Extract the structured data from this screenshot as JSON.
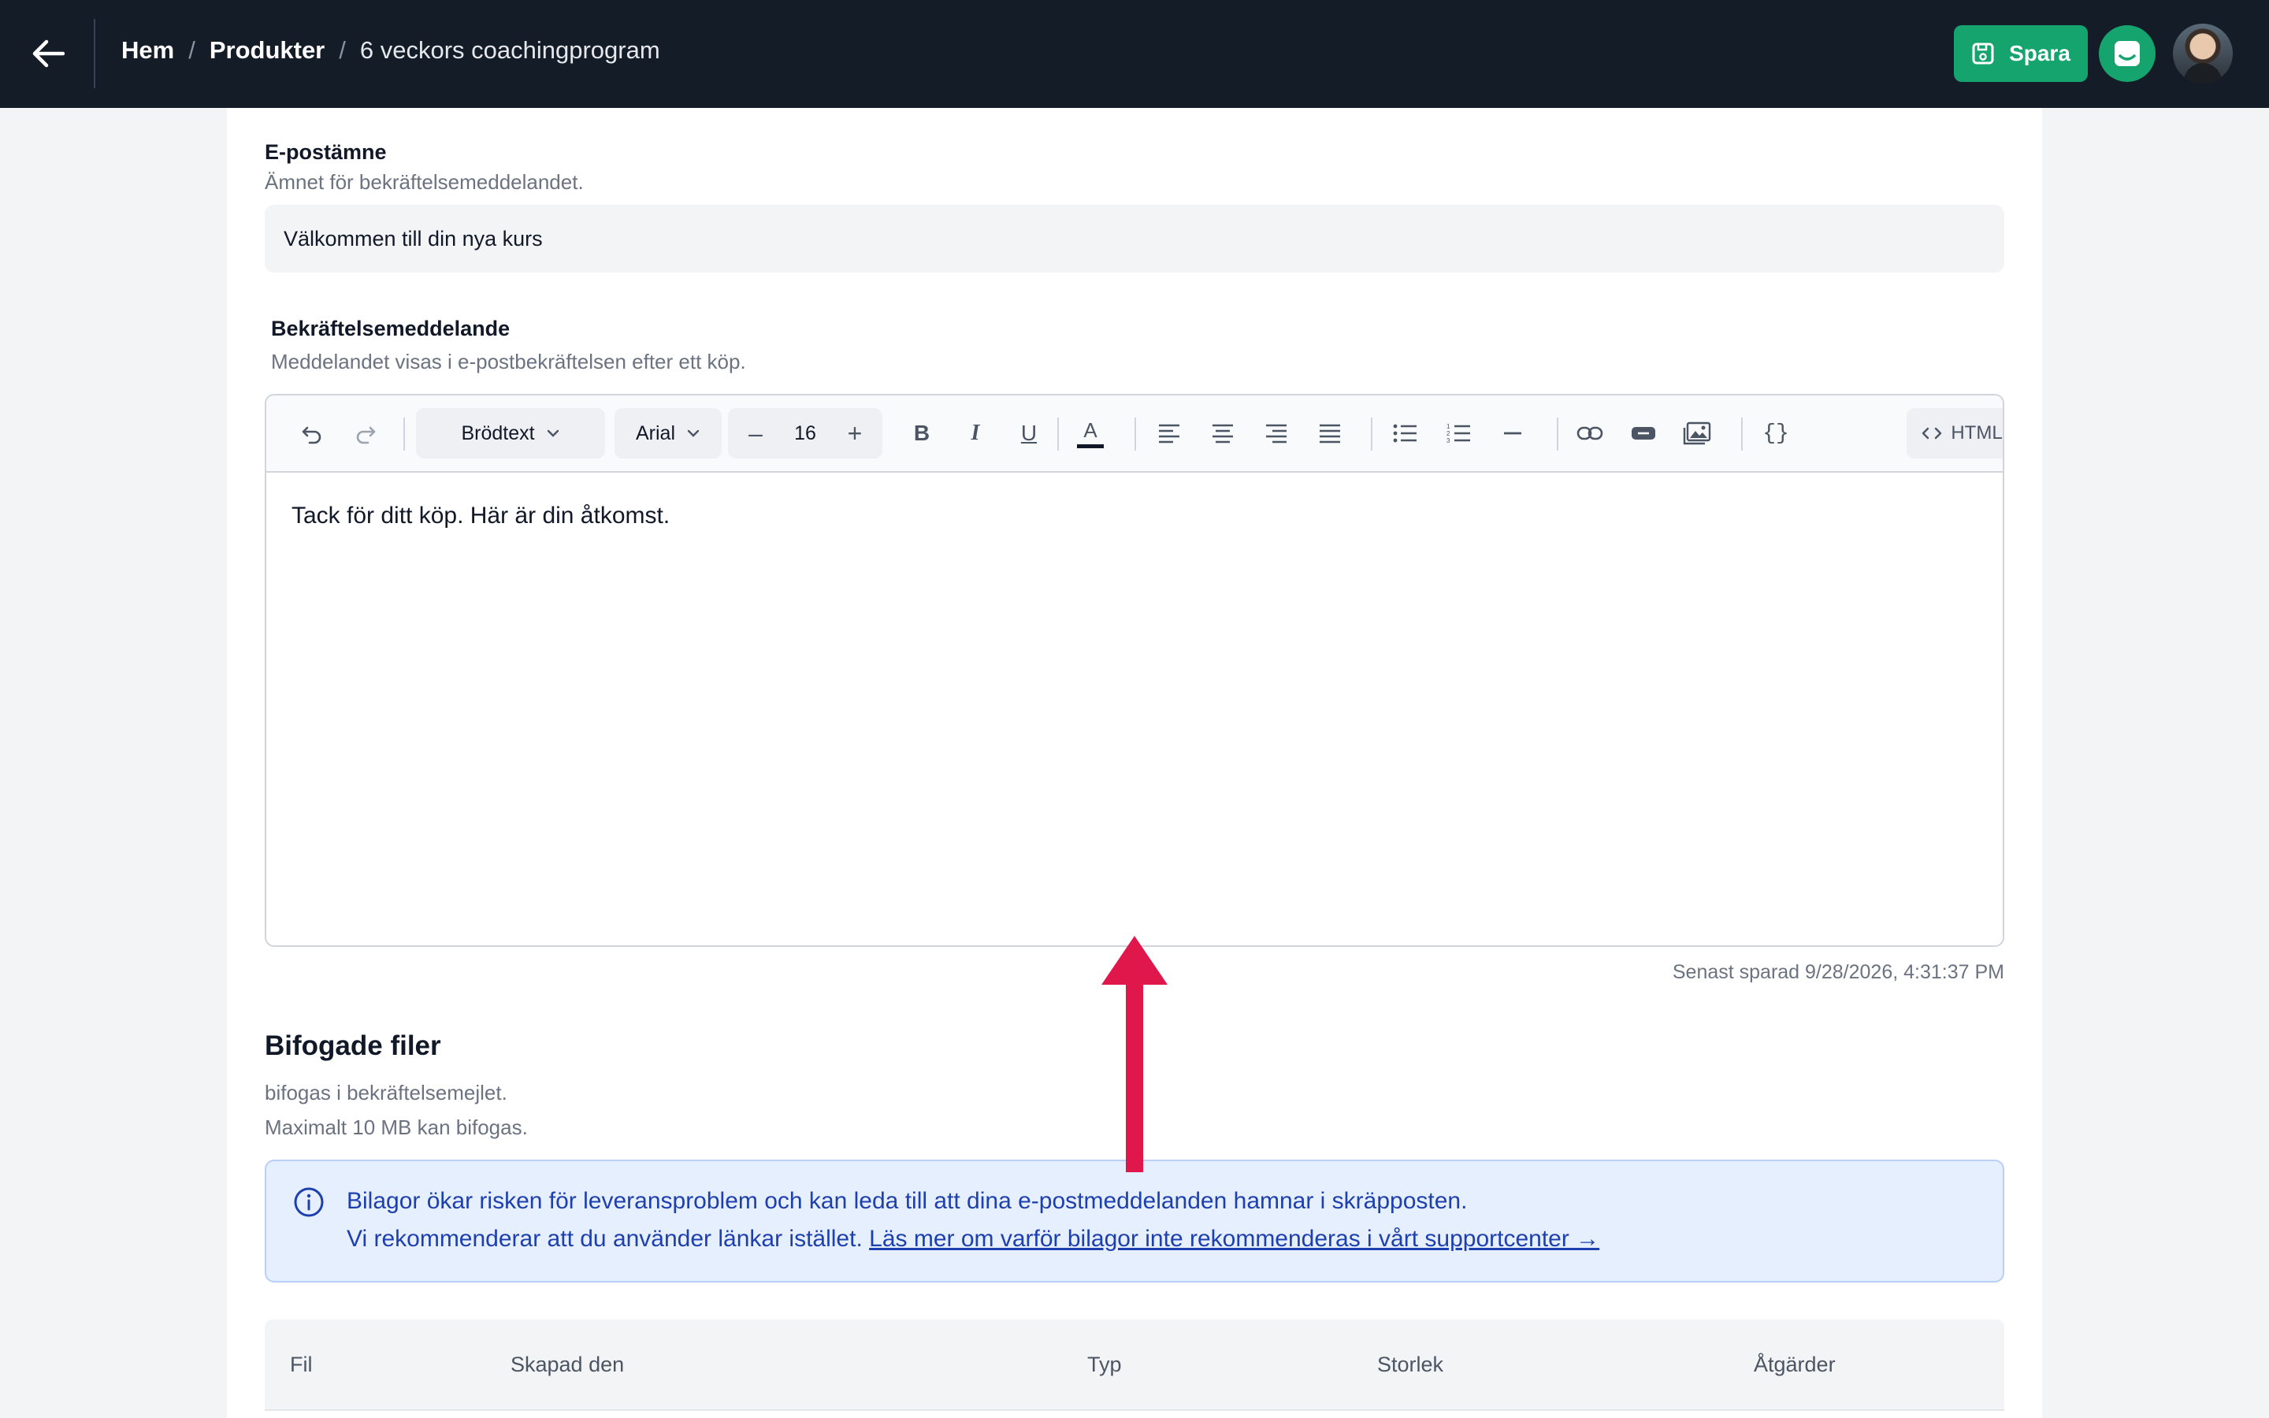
{
  "header": {
    "breadcrumb": {
      "home": "Hem",
      "separator": "/",
      "products": "Produkter",
      "current": "6 veckors coachingprogram"
    },
    "save_label": "Spara",
    "colors": {
      "bar": "#141c28",
      "accent": "#16a46e"
    }
  },
  "subject": {
    "label": "E-postämne",
    "help": "Ämnet för bekräftelsemeddelandet.",
    "value": "Välkommen till din nya kurs"
  },
  "message": {
    "label": "Bekräftelsemeddelande",
    "help": "Meddelandet visas i e-postbekräftelsen efter ett köp.",
    "toolbar": {
      "block_format": "Brödtext",
      "font_family": "Arial",
      "font_size_minus": "–",
      "font_size": "16",
      "font_size_plus": "+",
      "bold": "B",
      "italic": "I",
      "underline": "U",
      "text_color": "A",
      "variables": "{}",
      "html_label": "HTML"
    },
    "body": "Tack för ditt köp. Här är din åtkomst.",
    "last_saved": "Senast sparad 9/28/2026, 4:31:37 PM"
  },
  "attachments": {
    "title": "Bifogade filer",
    "help_line1": "bifogas i bekräftelsemejlet.",
    "help_line2": "Maximalt 10 MB kan bifogas.",
    "alert": {
      "line1": "Bilagor ökar risken för leveransproblem och kan leda till att dina e-postmeddelanden hamnar i skräpposten.",
      "line2_prefix": "Vi rekommenderar att du använder länkar istället.",
      "link": "Läs mer om varför bilagor inte rekommenderas i vårt supportcenter →"
    },
    "table": {
      "columns": [
        "Fil",
        "Skapad den",
        "Typ",
        "Storlek",
        "Åtgärder"
      ]
    }
  },
  "annotation": {
    "arrow_color": "#e0174a"
  }
}
